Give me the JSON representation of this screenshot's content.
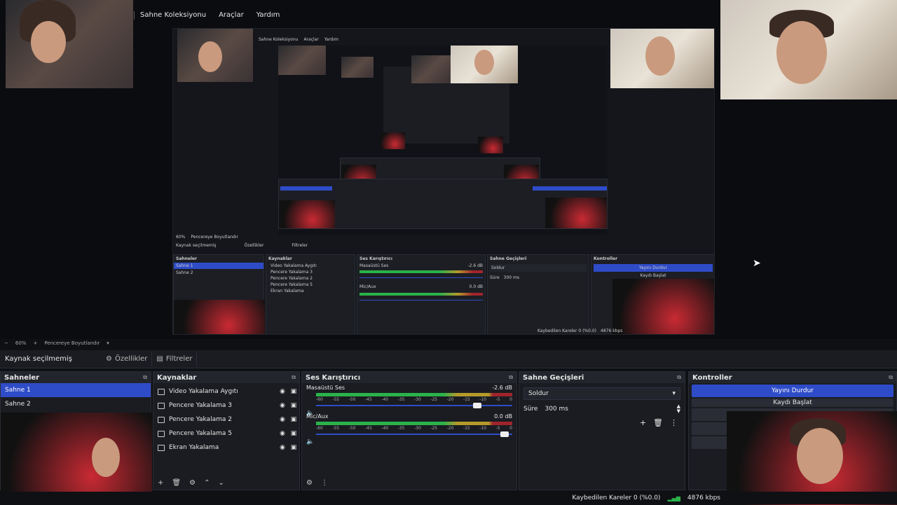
{
  "menu": {
    "items": [
      "Sahne Koleksiyonu",
      "Araçlar",
      "Yardım"
    ]
  },
  "preview_inner": {
    "menu": [
      "Sahne Koleksiyonu",
      "Araçlar",
      "Yardım"
    ],
    "zoom": "60%",
    "fit": "Pencereye Boyutlandır",
    "no_source": "Kaynak seçilmemiş",
    "props": "Özellikler",
    "filters": "Filtreler",
    "docks": [
      "Sahneler",
      "Kaynaklar",
      "Ses Karıştırıcı",
      "Sahne Geçişleri",
      "Kontroller"
    ],
    "scenes": [
      "Sahne 1",
      "Sahne 2"
    ],
    "sources": [
      "Video Yakalama Aygıtı",
      "Pencere Yakalama 3",
      "Pencere Yakalama 2",
      "Pencere Yakalama 5",
      "Ekran Yakalama"
    ],
    "mixer": [
      "Masaüstü Ses",
      "Mic/Aux"
    ],
    "mixer_db": [
      "-2.6 dB",
      "0.0 dB"
    ],
    "transition": "Soldur",
    "duration_label": "Süre",
    "duration_value": "300 ms",
    "stop_stream": "Yayını Durdur",
    "record_cut": "Kaydı Başlat",
    "status_frames": "Kaybedilen Kareler 0 (%0.0)",
    "status_kbps": "4876 kbps"
  },
  "zoom_strip": {
    "zoom": "60%",
    "fit": "Pencereye Boyutlandır"
  },
  "source_toolbar": {
    "no_source": "Kaynak seçilmemiş",
    "properties": "Özellikler",
    "filters": "Filtreler"
  },
  "scenes": {
    "title": "Sahneler",
    "items": [
      "Sahne 1",
      "Sahne 2"
    ],
    "selected": 0
  },
  "sources": {
    "title": "Kaynaklar",
    "items": [
      {
        "label": "Video Yakalama Aygıtı",
        "icon": "camera-icon"
      },
      {
        "label": "Pencere Yakalama 3",
        "icon": "window-icon"
      },
      {
        "label": "Pencere Yakalama 2",
        "icon": "window-icon"
      },
      {
        "label": "Pencere Yakalama 5",
        "icon": "window-icon"
      },
      {
        "label": "Ekran Yakalama",
        "icon": "monitor-icon"
      }
    ]
  },
  "mixer": {
    "title": "Ses Karıştırıcı",
    "channels": [
      {
        "name": "Masaüstü Ses",
        "db": "-2.6 dB",
        "level": 0.55,
        "volume": 0.9
      },
      {
        "name": "Mic/Aux",
        "db": "0.0 dB",
        "level": 0.45,
        "volume": 1.0
      }
    ],
    "scale": [
      "-60",
      "-55",
      "-50",
      "-45",
      "-40",
      "-35",
      "-30",
      "-25",
      "-20",
      "-15",
      "-10",
      "-5",
      "0"
    ]
  },
  "transitions": {
    "title": "Sahne Geçişleri",
    "selected": "Soldur",
    "duration_label": "Süre",
    "duration_value": "300 ms"
  },
  "controls": {
    "title": "Kontroller",
    "stop_stream": "Yayını Durdur",
    "start_record": "Kaydı Başlat"
  },
  "status": {
    "dropped_frames": "Kaybedilen Kareler 0 (%0.0)",
    "bitrate": "4876 kbps"
  },
  "icons": {
    "pop_out": "⧉",
    "eye": "👁",
    "lock": "🔒",
    "gear": "⚙",
    "menu_dots": "⋮"
  },
  "colors": {
    "accent": "#2f4cc8",
    "panel": "#1a1c21",
    "meter_green": "#2bb24a",
    "meter_yellow": "#b59a2b",
    "meter_red": "#a0242c"
  }
}
